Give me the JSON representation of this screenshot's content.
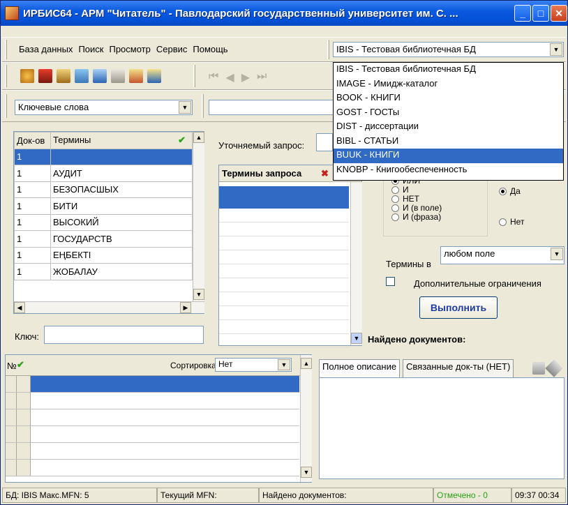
{
  "window": {
    "title": "ИРБИС64 - АРМ \"Читатель\" - Павлодарский государственный университет им. С. ..."
  },
  "menu": [
    "База данных",
    "Поиск",
    "Просмотр",
    "Сервис",
    "Помощь"
  ],
  "db_combo": {
    "value": "IBIS - Тестовая библиотечная БД"
  },
  "db_list": [
    "IBIS - Тестовая библиотечная БД",
    "IMAGE - Имидж-каталог",
    "BOOK - КНИГИ",
    "GOST - ГОСТы",
    "DIST - диссертации",
    "BIBL - СТАТЬИ",
    "BUUK - КНИГИ",
    "KNOBP - Книгообеспеченность"
  ],
  "db_list_selected": 6,
  "search_type": {
    "value": "Ключевые слова"
  },
  "terms_table": {
    "col_docs": "Док-ов",
    "col_terms": "Термины",
    "rows": [
      {
        "n": "1",
        "t": ""
      },
      {
        "n": "1",
        "t": "АУДИТ"
      },
      {
        "n": "1",
        "t": "БЕЗОПАСШЫХ"
      },
      {
        "n": "1",
        "t": "БИТИ"
      },
      {
        "n": "1",
        "t": "ВЫСОКИЙ"
      },
      {
        "n": "1",
        "t": "ГОСУДАРСТВ"
      },
      {
        "n": "1",
        "t": "ЕҢБЕКТІ"
      },
      {
        "n": "1",
        "t": "ЖОБАЛАУ"
      }
    ]
  },
  "key_label": "Ключ:",
  "refine_label": "Уточняемый запрос:",
  "query_terms_header": "Термины запроса",
  "logic": {
    "options": [
      "ИЛИ",
      "И",
      "НЕТ",
      "И (в поле)",
      "И (фраза)"
    ],
    "selected": 0
  },
  "truncation": {
    "options": [
      "Да",
      "Нет"
    ],
    "selected": 0
  },
  "terms_in_label": "Термины в",
  "terms_in_value": "любом поле",
  "extra_limits_label": "Дополнительные ограничения",
  "execute_button": "Выполнить",
  "found_label": "Найдено документов:",
  "results": {
    "col_no": "№",
    "sort_label": "Сортировка",
    "sort_value": "Нет"
  },
  "tabs": [
    "Полное описание",
    "Связанные док-ты (НЕТ)"
  ],
  "status": {
    "db": "БД: IBIS Макс.MFN: 5",
    "current": "Текущий MFN:",
    "found": "Найдено документов:",
    "marked": "Отмечено - 0",
    "time": "09:37  00:34"
  },
  "colors": {
    "title": "#0a5adf",
    "selection": "#316ac5",
    "marked": "#2aa317"
  }
}
